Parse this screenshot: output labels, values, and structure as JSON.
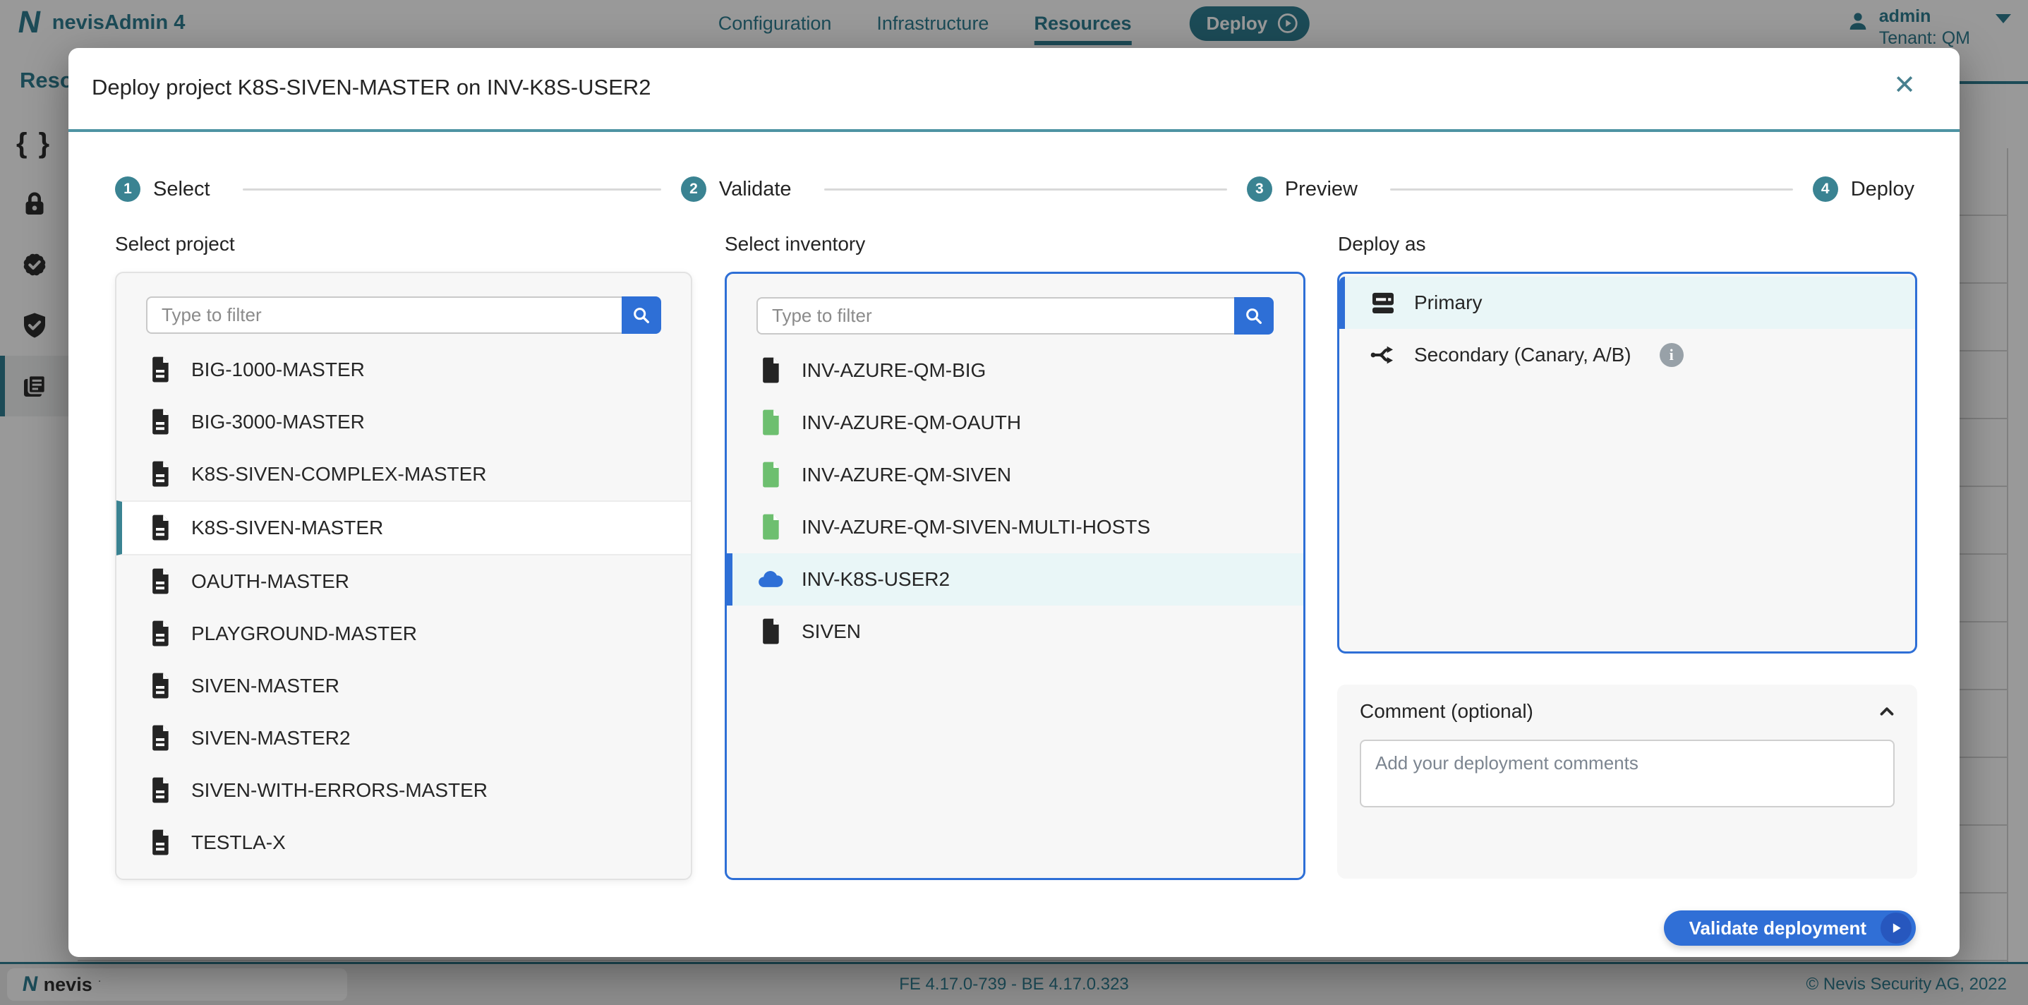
{
  "colors": {
    "teal": "#2f7e91",
    "blue": "#2e6fd6",
    "green": "#6dbf6f",
    "selected_cyan": "#e9f6f7",
    "info_gray": "#98a1a8"
  },
  "app": {
    "brand": "nevisAdmin 4",
    "nav": [
      {
        "label": "Configuration"
      },
      {
        "label": "Infrastructure"
      },
      {
        "label": "Resources",
        "selected": true
      }
    ],
    "deploy_button": "Deploy",
    "user": {
      "name": "admin",
      "tenant": "Tenant: QM"
    },
    "sidebar": {
      "heading": "Resources",
      "items": [
        {
          "icon": "braces"
        },
        {
          "icon": "lock"
        },
        {
          "icon": "certificate-check"
        },
        {
          "icon": "shield-check"
        },
        {
          "icon": "library",
          "selected": true
        }
      ]
    },
    "footer": {
      "logo": "nevis",
      "version": "FE 4.17.0-739 - BE 4.17.0.323",
      "copyright": "© Nevis Security AG, 2022"
    }
  },
  "modal": {
    "title": "Deploy project K8S-SIVEN-MASTER on INV-K8S-USER2",
    "steps": [
      {
        "num": "1",
        "label": "Select"
      },
      {
        "num": "2",
        "label": "Validate"
      },
      {
        "num": "3",
        "label": "Preview"
      },
      {
        "num": "4",
        "label": "Deploy"
      }
    ],
    "project": {
      "label": "Select project",
      "filter_placeholder": "Type to filter",
      "items": [
        {
          "name": "BIG-1000-MASTER",
          "icon": "file-lines"
        },
        {
          "name": "BIG-3000-MASTER",
          "icon": "file-lines"
        },
        {
          "name": "K8S-SIVEN-COMPLEX-MASTER",
          "icon": "file-lines"
        },
        {
          "name": "K8S-SIVEN-MASTER",
          "icon": "file-lines",
          "selected": true
        },
        {
          "name": "OAUTH-MASTER",
          "icon": "file-lines"
        },
        {
          "name": "PLAYGROUND-MASTER",
          "icon": "file-lines"
        },
        {
          "name": "SIVEN-MASTER",
          "icon": "file-lines"
        },
        {
          "name": "SIVEN-MASTER2",
          "icon": "file-lines"
        },
        {
          "name": "SIVEN-WITH-ERRORS-MASTER",
          "icon": "file-lines"
        },
        {
          "name": "TESTLA-X",
          "icon": "file-lines"
        }
      ]
    },
    "inventory": {
      "label": "Select inventory",
      "filter_placeholder": "Type to filter",
      "items": [
        {
          "name": "INV-AZURE-QM-BIG",
          "icon": "file-dark"
        },
        {
          "name": "INV-AZURE-QM-OAUTH",
          "icon": "file-green"
        },
        {
          "name": "INV-AZURE-QM-SIVEN",
          "icon": "file-green"
        },
        {
          "name": "INV-AZURE-QM-SIVEN-MULTI-HOSTS",
          "icon": "file-green"
        },
        {
          "name": "INV-K8S-USER2",
          "icon": "cloud",
          "selected": true
        },
        {
          "name": "SIVEN",
          "icon": "file-dark"
        }
      ]
    },
    "deploy_as": {
      "label": "Deploy as",
      "options": [
        {
          "name": "Primary",
          "icon": "server-inbox",
          "selected": true
        },
        {
          "name": "Secondary (Canary, A/B)",
          "icon": "split-arrows",
          "info": true
        }
      ]
    },
    "comment": {
      "label": "Comment (optional)",
      "placeholder": "Add your deployment comments"
    },
    "validate_button": "Validate deployment"
  }
}
